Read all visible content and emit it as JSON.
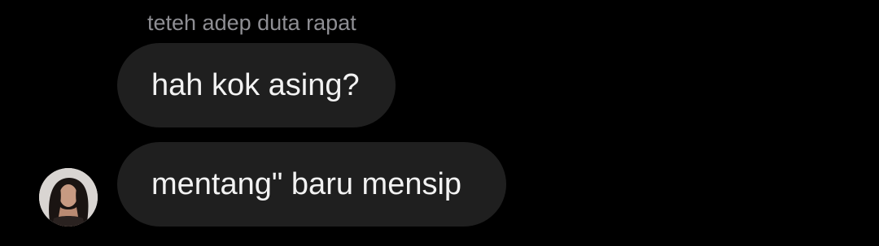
{
  "conversation": {
    "sender_name": "teteh adep duta rapat",
    "messages": [
      {
        "text": "hah kok asing?"
      },
      {
        "text": "mentang\" baru mensip"
      }
    ],
    "avatar": {
      "icon": "user-avatar-photo"
    }
  },
  "colors": {
    "background": "#000000",
    "bubble": "#1f1f1f",
    "message_text": "#f2f2f2",
    "sender_name": "#8e8e93"
  }
}
